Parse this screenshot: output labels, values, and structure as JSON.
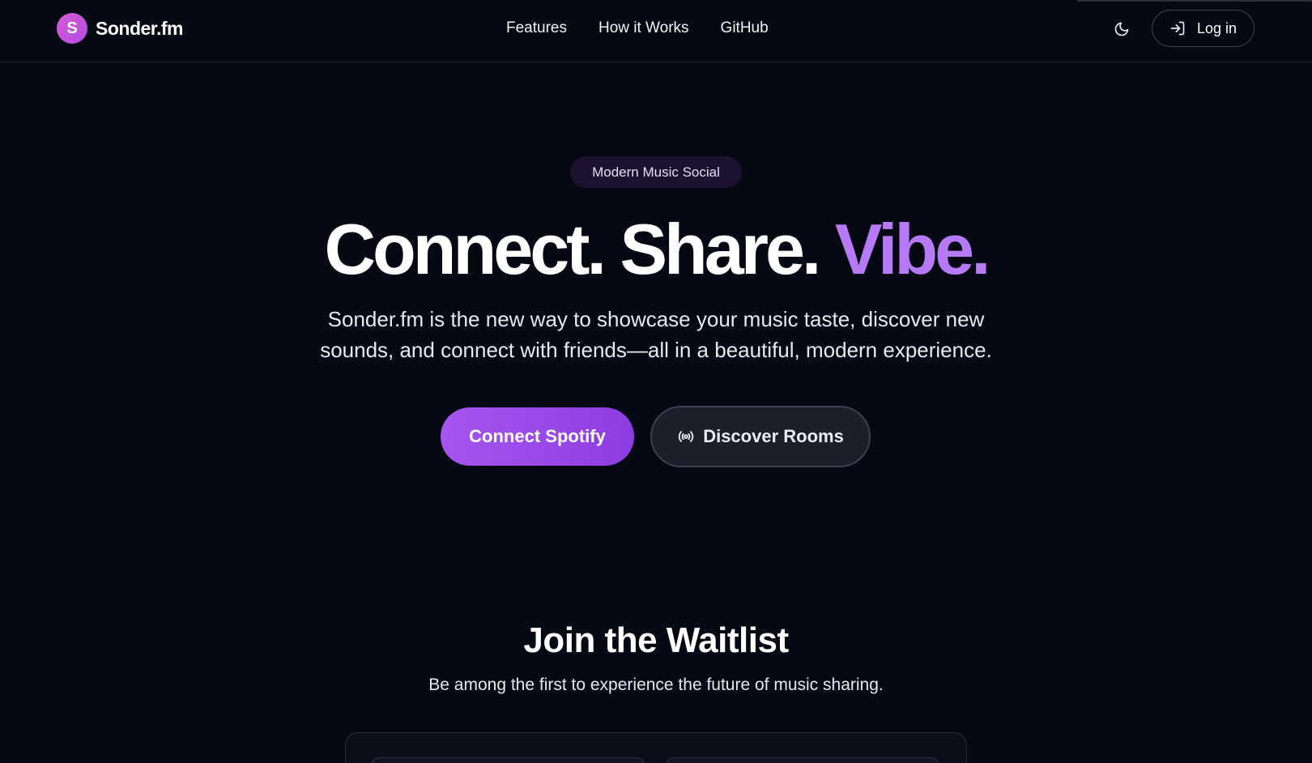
{
  "brand": {
    "logo_letter": "S",
    "name": "Sonder.fm"
  },
  "nav": {
    "items": [
      "Features",
      "How it Works",
      "GitHub"
    ]
  },
  "header": {
    "theme_icon": "moon-icon",
    "login_icon": "login-arrow-icon",
    "login_label": "Log in"
  },
  "hero": {
    "badge": "Modern Music Social",
    "headline_part1": "Connect. Share.",
    "headline_accent": "Vibe.",
    "subtitle_line1": "Sonder.fm is the new way to showcase your music taste, discover new",
    "subtitle_line2": "sounds, and connect with friends—all in a beautiful, modern experience.",
    "primary_button": "Connect Spotify",
    "secondary_button": "Discover Rooms",
    "secondary_icon": "broadcast-icon"
  },
  "waitlist": {
    "title": "Join the Waitlist",
    "subtitle": "Be among the first to experience the future of music sharing."
  },
  "colors": {
    "background": "#060814",
    "accent": "#b77af5",
    "primary_button": "#9a4ae8",
    "badge_bg": "#1c1230"
  }
}
